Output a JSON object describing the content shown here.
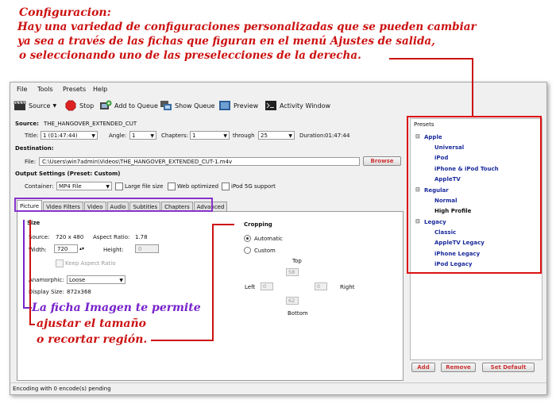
{
  "annotations": {
    "title": "Configuracion:",
    "intro_lines": [
      " Hay una variedad de configuraciones personalizadas que se pueden cambiar",
      "ya sea a través de las fichas que figuran en el menú Ajustes de salida,",
      "o seleccionando uno de las preselecciones de la derecha."
    ],
    "picture_lines": [
      "La ficha Imagen te permite",
      "ajustar el tamaño",
      "o recortar región."
    ]
  },
  "menu": [
    "File",
    "Tools",
    "Presets",
    "Help"
  ],
  "toolbar": {
    "source": "Source",
    "stop": "Stop",
    "add_to_queue": "Add to Queue",
    "show_queue": "Show Queue",
    "preview": "Preview",
    "activity_window": "Activity Window"
  },
  "source": {
    "label": "Source:",
    "name": "THE_HANGOVER_EXTENDED_CUT",
    "title_label": "Title:",
    "title_value": "1 (01:47:44)",
    "angle_label": "Angle:",
    "angle_value": "1",
    "chapters_label": "Chapters:",
    "chapter_from": "1",
    "through_label": "through",
    "chapter_to": "25",
    "duration_label": "Duration:",
    "duration_value": "01:47:44"
  },
  "destination": {
    "label": "Destination:",
    "file_label": "File:",
    "file_value": "C:\\Users\\win7admin\\Videos\\THE_HANGOVER_EXTENDED_CUT-1.m4v",
    "browse": "Browse"
  },
  "output": {
    "label": "Output Settings (Preset: Custom)",
    "container_label": "Container:",
    "container_value": "MP4 File",
    "large_file": "Large file size",
    "web_optimized": "Web optimized",
    "ipod_5g": "iPod 5G support"
  },
  "tabs": [
    "Picture",
    "Video Filters",
    "Video",
    "Audio",
    "Subtitles",
    "Chapters",
    "Advanced"
  ],
  "picture": {
    "size_label": "Size",
    "source_label": "Source:",
    "source_value": "720 x 480",
    "aspect_label": "Aspect Ratio:",
    "aspect_value": "1.78",
    "width_label": "Width:",
    "width_value": "720",
    "height_label": "Height:",
    "height_value": "0",
    "keep_aspect": "Keep Aspect Ratio",
    "anamorphic_label": "Anamorphic:",
    "anamorphic_value": "Loose",
    "display_label": "Display Size:",
    "display_value": "872x368",
    "cropping_label": "Cropping",
    "automatic": "Automatic",
    "custom": "Custom",
    "top_label": "Top",
    "top_value": "58",
    "left_label": "Left",
    "left_value": "0",
    "right_label": "Right",
    "right_value": "0",
    "bottom_label": "Bottom",
    "bottom_value": "62"
  },
  "presets": {
    "label": "Presets",
    "groups": [
      {
        "name": "Apple",
        "items": [
          "Universal",
          "iPod",
          "iPhone & iPod Touch",
          "AppleTV"
        ]
      },
      {
        "name": "Regular",
        "items": [
          "Normal",
          "High Profile"
        ]
      },
      {
        "name": "Legacy",
        "items": [
          "Classic",
          "AppleTV Legacy",
          "iPhone Legacy",
          "iPod Legacy"
        ]
      }
    ],
    "add": "Add",
    "remove": "Remove",
    "set_default": "Set Default"
  },
  "status": "Encoding with 0 encode(s) pending",
  "colors": {
    "annotation_red": "#cc1111",
    "annotation_purple": "#7722cc",
    "preset_blue": "#1a2a9c"
  }
}
